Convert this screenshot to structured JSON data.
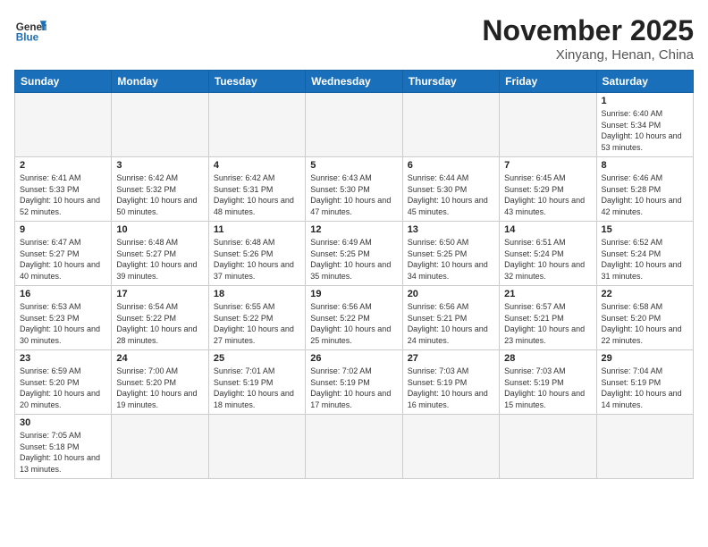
{
  "header": {
    "logo_general": "General",
    "logo_blue": "Blue",
    "month_title": "November 2025",
    "subtitle": "Xinyang, Henan, China"
  },
  "weekdays": [
    "Sunday",
    "Monday",
    "Tuesday",
    "Wednesday",
    "Thursday",
    "Friday",
    "Saturday"
  ],
  "weeks": [
    [
      {
        "day": "",
        "info": ""
      },
      {
        "day": "",
        "info": ""
      },
      {
        "day": "",
        "info": ""
      },
      {
        "day": "",
        "info": ""
      },
      {
        "day": "",
        "info": ""
      },
      {
        "day": "",
        "info": ""
      },
      {
        "day": "1",
        "info": "Sunrise: 6:40 AM\nSunset: 5:34 PM\nDaylight: 10 hours and 53 minutes."
      }
    ],
    [
      {
        "day": "2",
        "info": "Sunrise: 6:41 AM\nSunset: 5:33 PM\nDaylight: 10 hours and 52 minutes."
      },
      {
        "day": "3",
        "info": "Sunrise: 6:42 AM\nSunset: 5:32 PM\nDaylight: 10 hours and 50 minutes."
      },
      {
        "day": "4",
        "info": "Sunrise: 6:42 AM\nSunset: 5:31 PM\nDaylight: 10 hours and 48 minutes."
      },
      {
        "day": "5",
        "info": "Sunrise: 6:43 AM\nSunset: 5:30 PM\nDaylight: 10 hours and 47 minutes."
      },
      {
        "day": "6",
        "info": "Sunrise: 6:44 AM\nSunset: 5:30 PM\nDaylight: 10 hours and 45 minutes."
      },
      {
        "day": "7",
        "info": "Sunrise: 6:45 AM\nSunset: 5:29 PM\nDaylight: 10 hours and 43 minutes."
      },
      {
        "day": "8",
        "info": "Sunrise: 6:46 AM\nSunset: 5:28 PM\nDaylight: 10 hours and 42 minutes."
      }
    ],
    [
      {
        "day": "9",
        "info": "Sunrise: 6:47 AM\nSunset: 5:27 PM\nDaylight: 10 hours and 40 minutes."
      },
      {
        "day": "10",
        "info": "Sunrise: 6:48 AM\nSunset: 5:27 PM\nDaylight: 10 hours and 39 minutes."
      },
      {
        "day": "11",
        "info": "Sunrise: 6:48 AM\nSunset: 5:26 PM\nDaylight: 10 hours and 37 minutes."
      },
      {
        "day": "12",
        "info": "Sunrise: 6:49 AM\nSunset: 5:25 PM\nDaylight: 10 hours and 35 minutes."
      },
      {
        "day": "13",
        "info": "Sunrise: 6:50 AM\nSunset: 5:25 PM\nDaylight: 10 hours and 34 minutes."
      },
      {
        "day": "14",
        "info": "Sunrise: 6:51 AM\nSunset: 5:24 PM\nDaylight: 10 hours and 32 minutes."
      },
      {
        "day": "15",
        "info": "Sunrise: 6:52 AM\nSunset: 5:24 PM\nDaylight: 10 hours and 31 minutes."
      }
    ],
    [
      {
        "day": "16",
        "info": "Sunrise: 6:53 AM\nSunset: 5:23 PM\nDaylight: 10 hours and 30 minutes."
      },
      {
        "day": "17",
        "info": "Sunrise: 6:54 AM\nSunset: 5:22 PM\nDaylight: 10 hours and 28 minutes."
      },
      {
        "day": "18",
        "info": "Sunrise: 6:55 AM\nSunset: 5:22 PM\nDaylight: 10 hours and 27 minutes."
      },
      {
        "day": "19",
        "info": "Sunrise: 6:56 AM\nSunset: 5:22 PM\nDaylight: 10 hours and 25 minutes."
      },
      {
        "day": "20",
        "info": "Sunrise: 6:56 AM\nSunset: 5:21 PM\nDaylight: 10 hours and 24 minutes."
      },
      {
        "day": "21",
        "info": "Sunrise: 6:57 AM\nSunset: 5:21 PM\nDaylight: 10 hours and 23 minutes."
      },
      {
        "day": "22",
        "info": "Sunrise: 6:58 AM\nSunset: 5:20 PM\nDaylight: 10 hours and 22 minutes."
      }
    ],
    [
      {
        "day": "23",
        "info": "Sunrise: 6:59 AM\nSunset: 5:20 PM\nDaylight: 10 hours and 20 minutes."
      },
      {
        "day": "24",
        "info": "Sunrise: 7:00 AM\nSunset: 5:20 PM\nDaylight: 10 hours and 19 minutes."
      },
      {
        "day": "25",
        "info": "Sunrise: 7:01 AM\nSunset: 5:19 PM\nDaylight: 10 hours and 18 minutes."
      },
      {
        "day": "26",
        "info": "Sunrise: 7:02 AM\nSunset: 5:19 PM\nDaylight: 10 hours and 17 minutes."
      },
      {
        "day": "27",
        "info": "Sunrise: 7:03 AM\nSunset: 5:19 PM\nDaylight: 10 hours and 16 minutes."
      },
      {
        "day": "28",
        "info": "Sunrise: 7:03 AM\nSunset: 5:19 PM\nDaylight: 10 hours and 15 minutes."
      },
      {
        "day": "29",
        "info": "Sunrise: 7:04 AM\nSunset: 5:19 PM\nDaylight: 10 hours and 14 minutes."
      }
    ],
    [
      {
        "day": "30",
        "info": "Sunrise: 7:05 AM\nSunset: 5:18 PM\nDaylight: 10 hours and 13 minutes."
      },
      {
        "day": "",
        "info": ""
      },
      {
        "day": "",
        "info": ""
      },
      {
        "day": "",
        "info": ""
      },
      {
        "day": "",
        "info": ""
      },
      {
        "day": "",
        "info": ""
      },
      {
        "day": "",
        "info": ""
      }
    ]
  ]
}
